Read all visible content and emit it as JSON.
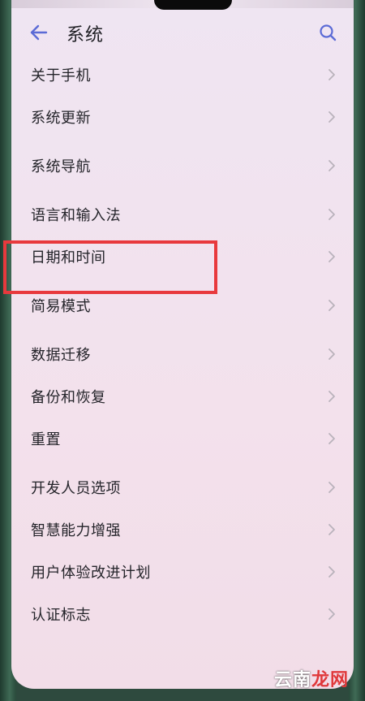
{
  "header": {
    "title": "系统"
  },
  "settings": {
    "items": [
      {
        "label": "关于手机"
      },
      {
        "label": "系统更新"
      },
      {
        "label": "系统导航"
      },
      {
        "label": "语言和输入法"
      },
      {
        "label": "日期和时间"
      },
      {
        "label": "简易模式"
      },
      {
        "label": "数据迁移"
      },
      {
        "label": "备份和恢复"
      },
      {
        "label": "重置"
      },
      {
        "label": "开发人员选项"
      },
      {
        "label": "智慧能力增强"
      },
      {
        "label": "用户体验改进计划"
      },
      {
        "label": "认证标志"
      }
    ]
  },
  "highlight": {
    "target": "日期和时间",
    "color": "#e8393d"
  },
  "watermark": {
    "part1": "云南",
    "part2": "龙网"
  },
  "colors": {
    "accent": "#5b6bd6",
    "text": "#24242a",
    "chevron": "#b9b2bb"
  },
  "icons": {
    "back": "arrow-left-icon",
    "search": "search-icon",
    "chevron": "chevron-right-icon"
  }
}
